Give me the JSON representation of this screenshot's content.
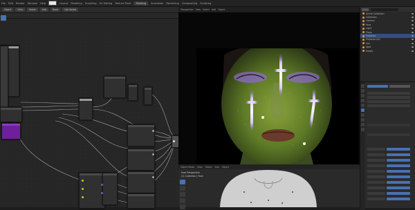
{
  "topbar": {
    "menus": [
      "File",
      "Edit",
      "Render",
      "Window",
      "Help"
    ],
    "workspaces": [
      "Layout",
      "Modeling",
      "Sculpting",
      "UV Editing",
      "Texture Paint",
      "Shading",
      "Animation",
      "Rendering",
      "Compositing",
      "Scripting"
    ],
    "active_workspace": "Shading"
  },
  "node_editor": {
    "header_buttons": [
      "Object",
      "View",
      "Select",
      "Add",
      "Node",
      "Use Nodes"
    ]
  },
  "viewport": {
    "header_tabs": [
      "Perspective",
      "View",
      "Select",
      "Add",
      "Object"
    ]
  },
  "viewport2": {
    "header_tabs": [
      "Object Mode",
      "View",
      "Select",
      "Add",
      "Object"
    ],
    "overlay_line1": "User Perspective",
    "overlay_line2": "(1) Collection | Face"
  },
  "outliner": {
    "rows": [
      {
        "label": "Scene Collection",
        "selected": false
      },
      {
        "label": "Collection",
        "selected": false
      },
      {
        "label": "Camera",
        "selected": false
      },
      {
        "label": "Face",
        "selected": false
      },
      {
        "label": "Light",
        "selected": false
      },
      {
        "label": "Plane",
        "selected": false
      },
      {
        "label": "Projector",
        "selected": true
      },
      {
        "label": "Projector.001",
        "selected": false
      },
      {
        "label": "Sun",
        "selected": false
      },
      {
        "label": "Spot",
        "selected": false
      },
      {
        "label": "Empty",
        "selected": false
      }
    ]
  },
  "colors": {
    "accent": "#4772b3",
    "node_purple": "#6f1f9a",
    "skin_green": "#6b8a2a",
    "glow_purple": "#9b6bff"
  }
}
